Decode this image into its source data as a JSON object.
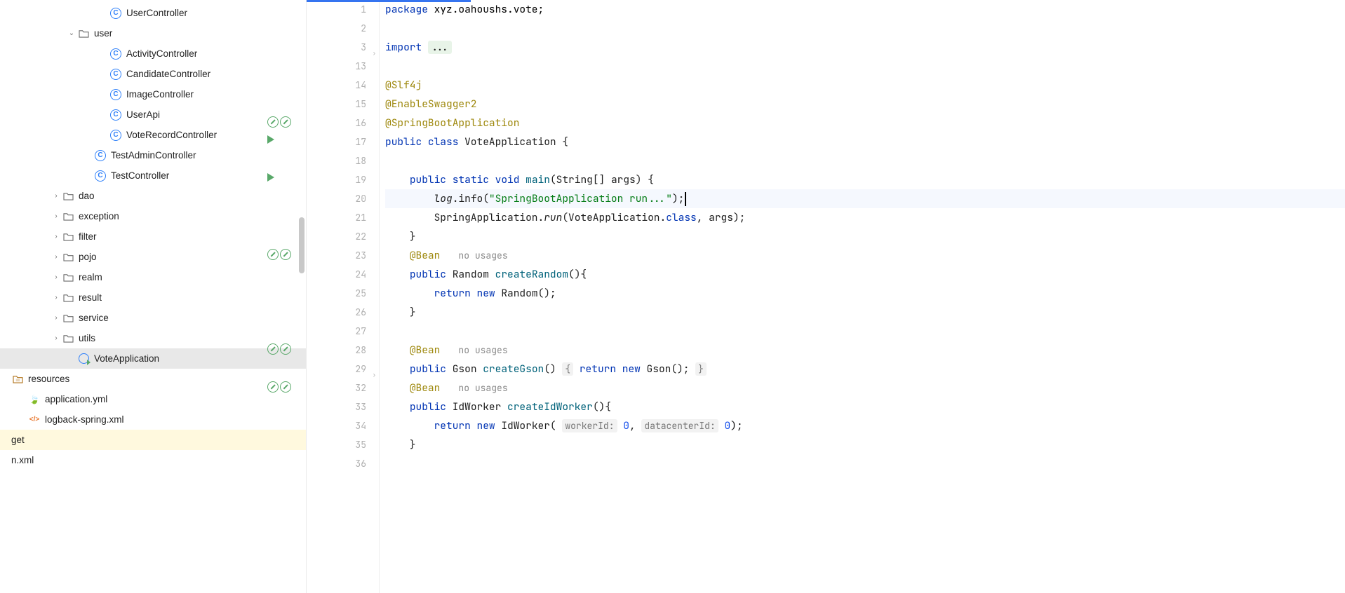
{
  "tree": [
    {
      "d": 140,
      "ico": "c",
      "lbl": "UserController"
    },
    {
      "d": 94,
      "ico": "fold",
      "chev": "down",
      "lbl": "user"
    },
    {
      "d": 140,
      "ico": "c",
      "lbl": "ActivityController"
    },
    {
      "d": 140,
      "ico": "c",
      "lbl": "CandidateController"
    },
    {
      "d": 140,
      "ico": "c",
      "lbl": "ImageController"
    },
    {
      "d": 140,
      "ico": "c",
      "lbl": "UserApi"
    },
    {
      "d": 140,
      "ico": "c",
      "lbl": "VoteRecordController"
    },
    {
      "d": 118,
      "ico": "c",
      "lbl": "TestAdminController"
    },
    {
      "d": 118,
      "ico": "c",
      "lbl": "TestController"
    },
    {
      "d": 72,
      "ico": "fold",
      "chev": "right",
      "lbl": "dao"
    },
    {
      "d": 72,
      "ico": "fold",
      "chev": "right",
      "lbl": "exception"
    },
    {
      "d": 72,
      "ico": "fold",
      "chev": "right",
      "lbl": "filter"
    },
    {
      "d": 72,
      "ico": "fold",
      "chev": "right",
      "lbl": "pojo"
    },
    {
      "d": 72,
      "ico": "fold",
      "chev": "right",
      "lbl": "realm"
    },
    {
      "d": 72,
      "ico": "fold",
      "chev": "right",
      "lbl": "result"
    },
    {
      "d": 72,
      "ico": "fold",
      "chev": "right",
      "lbl": "service"
    },
    {
      "d": 72,
      "ico": "fold",
      "chev": "right",
      "lbl": "utils"
    },
    {
      "d": 94,
      "ico": "app",
      "lbl": "VoteApplication",
      "sel": true
    },
    {
      "d": 0,
      "ico": "res",
      "lbl": "resources"
    },
    {
      "d": 24,
      "ico": "yml",
      "lbl": "application.yml"
    },
    {
      "d": 24,
      "ico": "xml",
      "lbl": "logback-spring.xml"
    },
    {
      "d": 0,
      "ico": "",
      "lbl": "get",
      "hl": true,
      "cut": true
    },
    {
      "d": 0,
      "ico": "",
      "lbl": "n.xml",
      "cut": true
    }
  ],
  "code": {
    "lines": [
      {
        "n": "1",
        "html": "<span class='kw'>package</span> <span class='pkg'>xyz.oahoushs.vote;</span>"
      },
      {
        "n": "2",
        "html": ""
      },
      {
        "n": "3",
        "html": "<span class='kw'>import</span> <span class='fold-dots'>...</span>",
        "fold": ">"
      },
      {
        "n": "13",
        "html": ""
      },
      {
        "n": "14",
        "html": "<span class='an'>@Slf4j</span>"
      },
      {
        "n": "15",
        "html": "<span class='an'>@EnableSwagger2</span>"
      },
      {
        "n": "16",
        "html": "<span class='an'>@SpringBootApplication</span>",
        "mark": "nb2"
      },
      {
        "n": "17",
        "html": "<span class='kw'>public</span> <span class='kw'>class</span> VoteApplication {",
        "mark": "run"
      },
      {
        "n": "18",
        "html": ""
      },
      {
        "n": "19",
        "html": "    <span class='kw'>public</span> <span class='kw'>static</span> <span class='kw'>void</span> <span class='fn'>main</span>(String[] args) {",
        "mark": "run"
      },
      {
        "n": "20",
        "html": "        <span class='it'>log</span>.info(<span class='str'>\"SpringBootApplication run...\"</span>);<span class='cursor-line'></span>",
        "cur": true
      },
      {
        "n": "21",
        "html": "        SpringApplication.<span class='it'>run</span>(VoteApplication.<span class='kw'>class</span>, args);"
      },
      {
        "n": "22",
        "html": "    }"
      },
      {
        "n": "23",
        "html": "    <span class='an'>@Bean</span>   <span class='hint'>no usages</span>",
        "mark": "nb2"
      },
      {
        "n": "24",
        "html": "    <span class='kw'>public</span> Random <span class='fn'>createRandom</span>(){"
      },
      {
        "n": "25",
        "html": "        <span class='kw'>return</span> <span class='kw'>new</span> Random();"
      },
      {
        "n": "26",
        "html": "    }"
      },
      {
        "n": "27",
        "html": ""
      },
      {
        "n": "28",
        "html": "    <span class='an'>@Bean</span>   <span class='hint'>no usages</span>",
        "mark": "nb2"
      },
      {
        "n": "29",
        "html": "    <span class='kw'>public</span> Gson <span class='fn'>createGson</span>() <span class='hbox'>{</span> <span class='kw'>return</span> <span class='kw'>new</span> Gson(); <span class='hbox'>}</span>",
        "fold": ">"
      },
      {
        "n": "32",
        "html": "    <span class='an'>@Bean</span>   <span class='hint'>no usages</span>",
        "mark": "nb2"
      },
      {
        "n": "33",
        "html": "    <span class='kw'>public</span> IdWorker <span class='fn'>createIdWorker</span>(){"
      },
      {
        "n": "34",
        "html": "        <span class='kw'>return</span> <span class='kw'>new</span> IdWorker( <span class='hbox'>workerId:</span> <span class='num'>0</span>, <span class='hbox'>datacenterId:</span> <span class='num'>0</span>);"
      },
      {
        "n": "35",
        "html": "    }"
      },
      {
        "n": "36",
        "html": ""
      }
    ]
  }
}
